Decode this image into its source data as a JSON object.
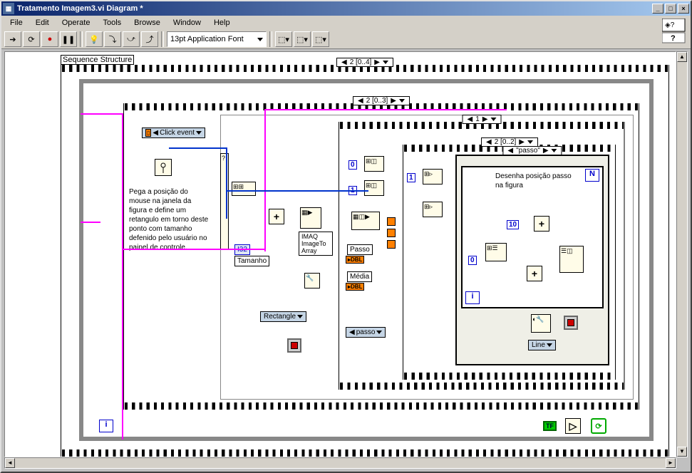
{
  "window": {
    "title": "Tratamento Imagem3.vi Diagram *"
  },
  "menus": [
    "File",
    "Edit",
    "Operate",
    "Tools",
    "Browse",
    "Window",
    "Help"
  ],
  "toolbar": {
    "font": "13pt Application Font"
  },
  "struct_label": "Sequence Structure",
  "frames": {
    "outer": "2 [0..4]",
    "second": "2 [0..3]",
    "third": "1",
    "inner": "2 [0..2]",
    "case": "\"passo\""
  },
  "comment_left": "Pega a posição do mouse na janela da figura e define um retangulo em torno deste ponto com tamanho defenido pelo usuário no painel de controle.",
  "comment_right": "Desenha posição passo na figura",
  "controls": {
    "click_event": "Click event",
    "tamanho": "Tamanho",
    "rectangle": "Rectangle",
    "passo_sel": "passo",
    "line": "Line"
  },
  "nodes": {
    "imaq": "IMAQ\nImageTo\nArray",
    "i32": "I32"
  },
  "indicators": {
    "passo": "Passo",
    "media": "Média"
  },
  "constants": {
    "c0a": "0",
    "c1a": "1",
    "c10": "10",
    "c0b": "0",
    "c1b": "1"
  },
  "terminals": {
    "n": "N",
    "i1": "i",
    "i2": "i"
  },
  "tf": "TF",
  "dbl": "DBL",
  "scroll": {
    "left": "◄",
    "right": "►",
    "up": "▲",
    "down": "▼"
  }
}
